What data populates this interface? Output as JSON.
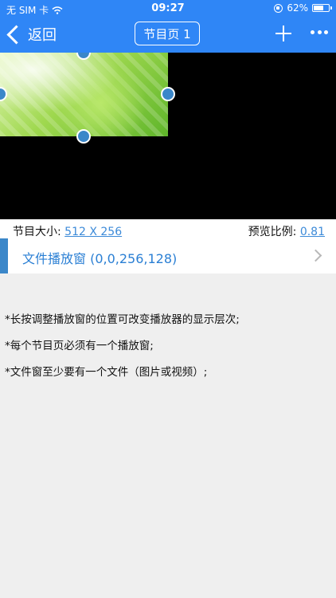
{
  "status_bar": {
    "carrier": "无 SIM 卡",
    "time": "09:27",
    "battery": "62%",
    "battery_level": 0.62
  },
  "nav": {
    "back_label": "返回",
    "title": "节目页 1"
  },
  "program": {
    "size_label": "节目大小: ",
    "size_value": "512 X 256",
    "scale_label": "预览比例: ",
    "scale_value": "0.81"
  },
  "window": {
    "label": "文件播放窗 (0,0,256,128)"
  },
  "tips": [
    "*长按调整播放窗的位置可改变播放器的显示层次;",
    "*每个节目页必须有一个播放窗;",
    "*文件窗至少要有一个文件（图片或视频）;"
  ],
  "colors": {
    "primary": "#2f86f6",
    "accent": "#3b87c9",
    "link": "#3c8ad8"
  }
}
